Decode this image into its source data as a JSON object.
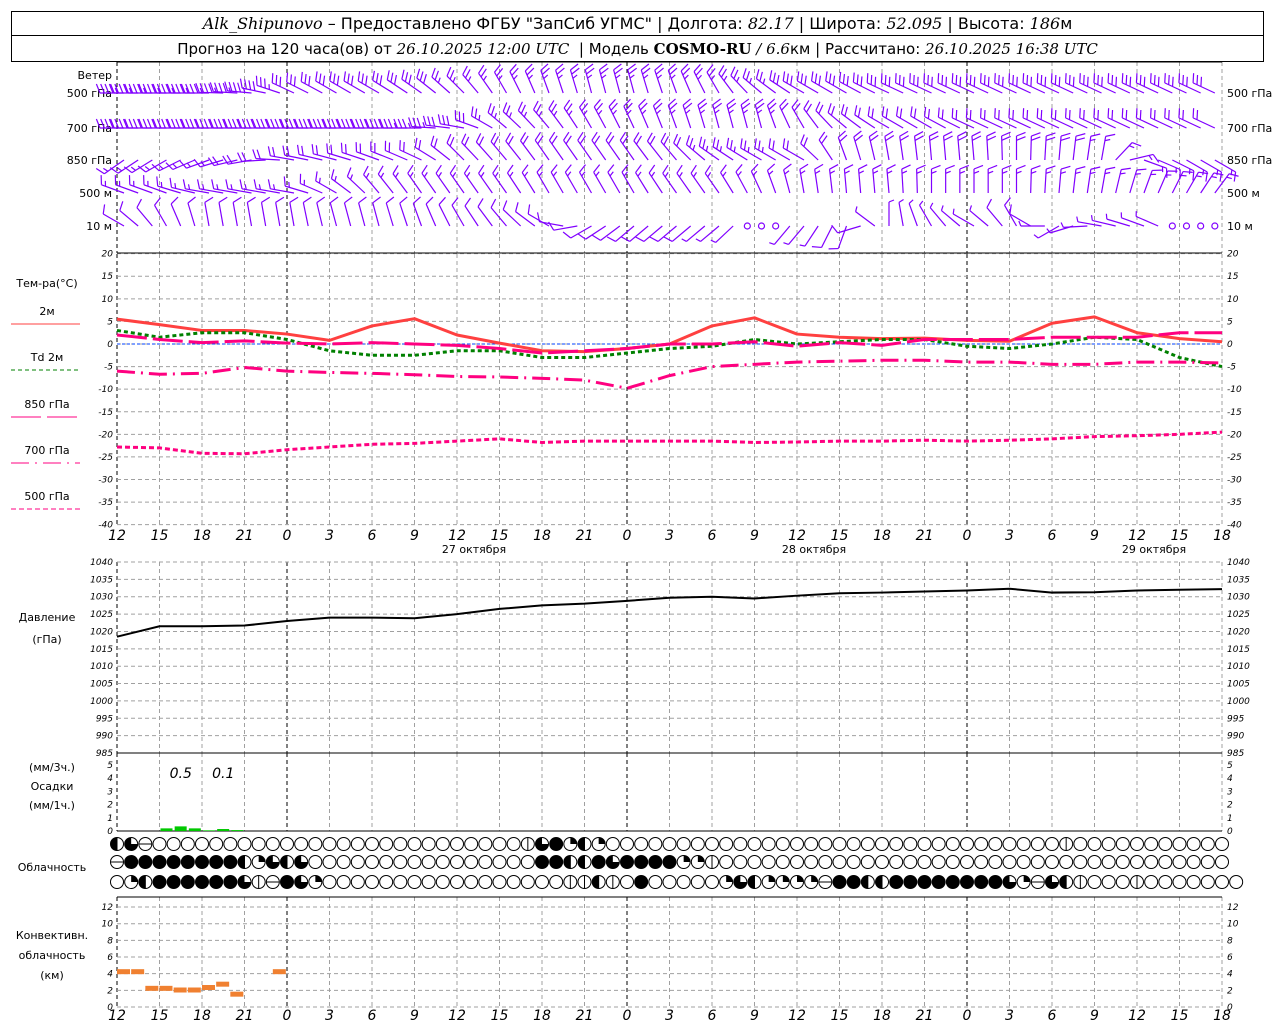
{
  "header": {
    "station": "Alk_Shipunovo",
    "provided": " – Предоставлено ФГБУ \"ЗапСиб УГМС\" | ",
    "lon_label": "Долгота: ",
    "lon": "82.17",
    "lat_label": " | Широта: ",
    "lat": "52.095",
    "alt_label": " | Высота: ",
    "alt": "186",
    "alt_unit": "м",
    "forecast_label": "Прогноз на 120 часа(ов) от ",
    "forecast_start": "26.10.2025 12:00 UTC",
    "model_label": "  | Модель ",
    "model": "COSMO-RU",
    "resolution": " / 6.6",
    "res_unit": "км",
    "computed_label": " | Рассчитано: ",
    "computed": "26.10.2025 16:38 UTC"
  },
  "labels": {
    "wind": "Ветер",
    "wind_levels": [
      "500 гПа",
      "700 гПа",
      "850 гПа",
      "500 м",
      "10 м"
    ],
    "temp_title": "Тем-ра(°C)",
    "temp_legend": [
      "2м",
      "Td 2м",
      "850 гПа",
      "700 гПа",
      "500 гПа"
    ],
    "pressure": [
      "Давление",
      "(гПа)"
    ],
    "precip": [
      "(мм/3ч.)",
      "Осадки",
      "(мм/1ч.)"
    ],
    "clouds": "Облачность",
    "convective": [
      "Конвективн.",
      "облачность",
      "(км)"
    ]
  },
  "colors": {
    "wind": "#8000ff",
    "t2m": "#ff4040",
    "td2m": "#008000",
    "t850": "#ff0080",
    "t700": "#ff0080",
    "t500": "#ff0080",
    "zero": "#0040ff",
    "precip": "#00c800",
    "convective": "#f08030",
    "grid": "#a0a0a0"
  },
  "chart_data": {
    "type": "line",
    "x_hours_step": 3,
    "x_hour_labels": [
      "12",
      "15",
      "18",
      "21",
      "0",
      "3",
      "6",
      "9",
      "12",
      "15",
      "18",
      "21",
      "0",
      "3",
      "6",
      "9",
      "12",
      "15",
      "18",
      "21",
      "0",
      "3",
      "6",
      "9",
      "12",
      "15",
      "18"
    ],
    "date_labels": [
      "27 октября",
      "28 октября",
      "29 октября"
    ],
    "wind": {
      "levels": [
        "500 гПа",
        "700 гПа",
        "850 гПа",
        "500 м",
        "10 м"
      ],
      "direction_deg": [
        [
          270,
          270,
          270,
          275,
          295,
          300,
          300,
          305,
          315,
          330,
          340,
          345,
          345,
          340,
          330,
          310,
          300,
          300,
          295,
          295,
          295,
          295,
          295,
          295,
          295,
          295,
          295
        ],
        [
          270,
          270,
          270,
          270,
          270,
          270,
          270,
          270,
          280,
          310,
          320,
          330,
          335,
          340,
          345,
          345,
          330,
          310,
          300,
          300,
          295,
          295,
          295,
          295,
          295,
          295,
          295
        ],
        [
          235,
          240,
          250,
          260,
          280,
          285,
          290,
          295,
          315,
          320,
          325,
          325,
          325,
          320,
          305,
          300,
          300,
          340,
          350,
          355,
          355,
          0,
          5,
          10,
          110,
          120,
          120
        ],
        [
          290,
          290,
          280,
          280,
          280,
          300,
          320,
          325,
          325,
          325,
          330,
          330,
          330,
          325,
          325,
          335,
          350,
          355,
          355,
          0,
          0,
          0,
          5,
          10,
          20,
          30,
          40
        ],
        [
          300,
          330,
          350,
          350,
          350,
          345,
          345,
          340,
          330,
          320,
          300,
          240,
          230,
          230,
          230,
          220,
          220,
          200,
          0,
          330,
          300,
          330,
          240,
          280,
          290,
          300,
          270
        ]
      ],
      "speed": [
        [
          45,
          45,
          45,
          45,
          30,
          30,
          30,
          30,
          25,
          25,
          25,
          25,
          25,
          25,
          25,
          25,
          30,
          30,
          30,
          30,
          30,
          30,
          30,
          30,
          30,
          30,
          30
        ],
        [
          40,
          40,
          40,
          40,
          40,
          40,
          40,
          35,
          30,
          25,
          25,
          25,
          25,
          25,
          25,
          25,
          20,
          20,
          20,
          20,
          20,
          20,
          20,
          20,
          20,
          20,
          20
        ],
        [
          15,
          15,
          15,
          20,
          20,
          20,
          20,
          20,
          20,
          20,
          20,
          20,
          20,
          20,
          25,
          25,
          20,
          20,
          20,
          20,
          20,
          20,
          20,
          15,
          15,
          15,
          15
        ],
        [
          15,
          15,
          15,
          15,
          15,
          15,
          15,
          15,
          15,
          15,
          15,
          15,
          15,
          15,
          15,
          15,
          15,
          15,
          15,
          15,
          15,
          15,
          15,
          15,
          15,
          15,
          15
        ],
        [
          10,
          10,
          10,
          10,
          10,
          10,
          10,
          10,
          10,
          10,
          10,
          10,
          10,
          10,
          5,
          0,
          5,
          10,
          5,
          5,
          5,
          10,
          5,
          5,
          5,
          0,
          0
        ]
      ]
    },
    "temperature": {
      "ylim": [
        -40,
        20
      ],
      "yticks": [
        20,
        15,
        10,
        5,
        0,
        -5,
        -10,
        -15,
        -20,
        -25,
        -30,
        -35,
        -40
      ],
      "series": [
        {
          "name": "2м",
          "style": "solid",
          "values": [
            5.5,
            4.3,
            3,
            3,
            2.2,
            0.8,
            4,
            5.6,
            2,
            0.2,
            -1.5,
            -1.7,
            -1,
            0,
            4,
            5.8,
            2.2,
            1.5,
            1.2,
            1.3,
            0.8,
            0.6,
            4.6,
            6,
            2.5,
            1.2,
            0.5
          ]
        },
        {
          "name": "Td 2м",
          "style": "dotted",
          "values": [
            3,
            1.5,
            2.5,
            2.5,
            1,
            -1.5,
            -2.5,
            -2.5,
            -1.5,
            -1.5,
            -3,
            -3,
            -2,
            -1,
            -0.5,
            1,
            0,
            0.5,
            1,
            1,
            -0.5,
            -1,
            0,
            1.5,
            1,
            -3,
            -5
          ]
        },
        {
          "name": "850 гПа",
          "style": "longdash",
          "values": [
            2,
            1,
            0.3,
            0.7,
            0.2,
            0,
            0.3,
            0,
            -0.3,
            -1,
            -2,
            -1.5,
            -1,
            0,
            0,
            0.5,
            -0.5,
            0.3,
            -0.3,
            1,
            1,
            1,
            1.5,
            1.5,
            1.5,
            2.5,
            2.5
          ]
        },
        {
          "name": "700 гПа",
          "style": "dashdot",
          "values": [
            -6,
            -6.7,
            -6.5,
            -5.2,
            -6,
            -6.3,
            -6.5,
            -6.8,
            -7.2,
            -7.3,
            -7.6,
            -8,
            -9.8,
            -7,
            -5,
            -4.5,
            -4,
            -3.8,
            -3.6,
            -3.6,
            -4,
            -4,
            -4.5,
            -4.5,
            -4,
            -4,
            -4.2
          ]
        },
        {
          "name": "500 гПа",
          "style": "shortdash",
          "values": [
            -22.8,
            -23,
            -24.2,
            -24.3,
            -23.4,
            -22.8,
            -22.2,
            -22,
            -21.5,
            -21,
            -21.8,
            -21.5,
            -21.5,
            -21.5,
            -21.5,
            -21.8,
            -21.7,
            -21.5,
            -21.5,
            -21.3,
            -21.5,
            -21.3,
            -21,
            -20.5,
            -20.3,
            -20,
            -19.5
          ]
        }
      ]
    },
    "pressure": {
      "ylim": [
        985,
        1040
      ],
      "yticks": [
        1040,
        1035,
        1030,
        1025,
        1020,
        1015,
        1010,
        1005,
        1000,
        995,
        990,
        985
      ],
      "values": [
        1018.5,
        1021.5,
        1021.5,
        1021.7,
        1023,
        1024,
        1024,
        1023.8,
        1025,
        1026.5,
        1027.5,
        1028,
        1028.8,
        1029.7,
        1030,
        1029.5,
        1030.3,
        1031,
        1031.2,
        1031.5,
        1031.8,
        1032.3,
        1031.2,
        1031.3,
        1031.8,
        1032,
        1032.2
      ]
    },
    "precipitation": {
      "ylim": [
        0,
        5
      ],
      "yticks": [
        5,
        4,
        3,
        2,
        1,
        0
      ],
      "hourly": [
        {
          "hour": 3,
          "mm": 0.2
        },
        {
          "hour": 4,
          "mm": 0.35
        },
        {
          "hour": 5,
          "mm": 0.2
        },
        {
          "hour": 6,
          "mm": 0.05
        },
        {
          "hour": 7,
          "mm": 0.15
        },
        {
          "hour": 8,
          "mm": 0.07
        }
      ],
      "three_hour_totals": [
        {
          "hour_start": 3,
          "label": "0.5"
        },
        {
          "hour_start": 6,
          "label": "0.1"
        }
      ]
    },
    "cloudiness": {
      "codes_legend": "e=clear,q=quarter,b=half,t=three-quarter,f=overcast,v=vertical-bar,h=horizontal-bar",
      "rows": [
        "btheeeeeeeeeeeeeeeeeeeeeeeeeevtfqbqeeeeeeeeeeeeeeeeeeeeeeeeeeeeeeeeveeeeeeeeeee",
        "hffffffffbqtbteeeeeeeeeeeeeeeeffbbftffffqqveeeeeeeeeeeeeeeeeeeeeeeeeeeeeeeeeeee",
        "eqbfffffftvhftqeeeeeeeeeeeeeeeeevvbvefeeeeeqtbqqqqhffbbfffffffftqhtbveeeveeeeeee"
      ]
    },
    "convective": {
      "ylim": [
        0,
        13
      ],
      "yticks": [
        12,
        10,
        8,
        6,
        4,
        2,
        0
      ],
      "segments": [
        {
          "hour": 0,
          "km": 4.3
        },
        {
          "hour": 1,
          "km": 4.3
        },
        {
          "hour": 2,
          "km": 2.3
        },
        {
          "hour": 3,
          "km": 2.3
        },
        {
          "hour": 4,
          "km": 2.1
        },
        {
          "hour": 5,
          "km": 2.1
        },
        {
          "hour": 6,
          "km": 2.4
        },
        {
          "hour": 7,
          "km": 2.8
        },
        {
          "hour": 8,
          "km": 1.6
        },
        {
          "hour": 11,
          "km": 4.3
        }
      ]
    }
  }
}
